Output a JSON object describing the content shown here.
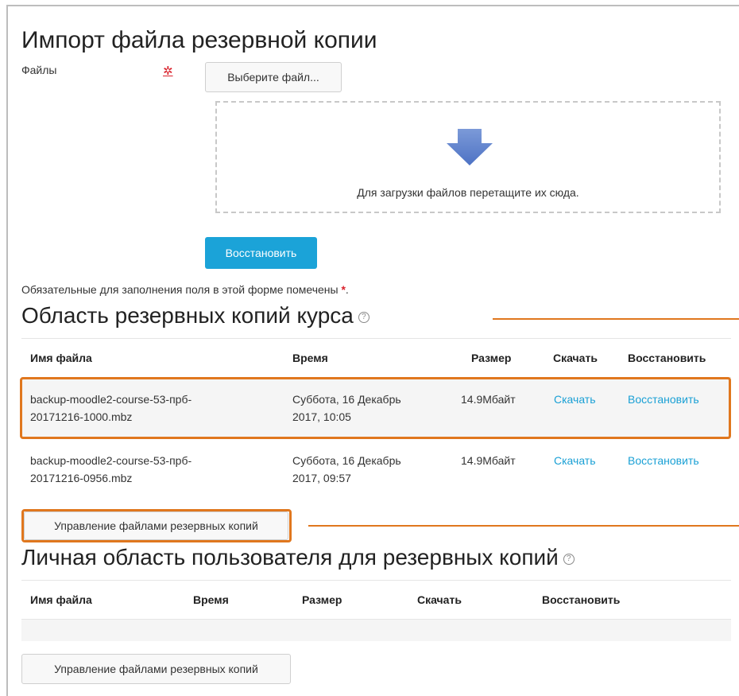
{
  "page": {
    "title": "Импорт файла резервной копии"
  },
  "form": {
    "files_label": "Файлы",
    "required_mark": "✲",
    "choose_button": "Выберите файл...",
    "dropzone_text": "Для загрузки файлов перетащите их сюда.",
    "restore_button": "Восстановить",
    "required_note": "Обязательные для заполнения поля в этой форме помечены",
    "required_star": "*",
    "required_dot": "."
  },
  "course_backups": {
    "title": "Область резервных копий курса",
    "help_icon": "?",
    "columns": [
      "Имя файла",
      "Время",
      "Размер",
      "Скачать",
      "Восстановить"
    ],
    "rows": [
      {
        "name_line1": "backup-moodle2-course-53-прб-",
        "name_line2": "20171216-1000.mbz",
        "time_line1": "Суббота, 16 Декабрь",
        "time_line2": "2017, 10:05",
        "size": "14.9Мбайт",
        "download": "Скачать",
        "restore": "Восстановить"
      },
      {
        "name_line1": "backup-moodle2-course-53-прб-",
        "name_line2": "20171216-0956.mbz",
        "time_line1": "Суббота, 16 Декабрь",
        "time_line2": "2017, 09:57",
        "size": "14.9Мбайт",
        "download": "Скачать",
        "restore": "Восстановить"
      }
    ],
    "manage_button": "Управление файлами резервных копий"
  },
  "user_backups": {
    "title": "Личная область пользователя для резервных копий",
    "help_icon": "?",
    "columns": [
      "Имя файла",
      "Время",
      "Размер",
      "Скачать",
      "Восстановить"
    ],
    "manage_button": "Управление файлами резервных копий"
  },
  "colors": {
    "accent": "#1ba3d8",
    "link": "#1aa0d5",
    "highlight": "#e0771e",
    "required": "#d9232d"
  }
}
